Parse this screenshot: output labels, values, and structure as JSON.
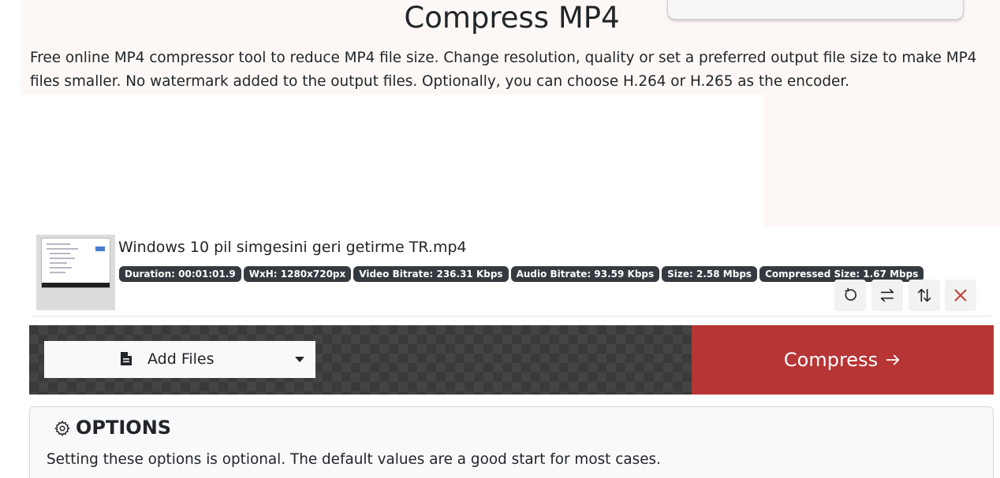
{
  "page": {
    "title": "Compress MP4",
    "description": "Free online MP4 compressor tool to reduce MP4 file size. Change resolution, quality or set a preferred output file size to make MP4 files smaller. No watermark added to the output files. Optionally, you can choose H.264 or H.265 as the encoder."
  },
  "file": {
    "name": "Windows 10 pil simgesini geri getirme TR.mp4",
    "badges": [
      "Duration: 00:01:01.9",
      "WxH: 1280x720px",
      "Video Bitrate: 236.31 Kbps",
      "Audio Bitrate: 93.59 Kbps",
      "Size: 2.58 Mbps",
      "Compressed Size: 1.67 Mbps"
    ],
    "actions": [
      "rotate-icon",
      "swap-horizontal-icon",
      "swap-vertical-icon",
      "close-icon"
    ]
  },
  "toolbar": {
    "add_files_label": "Add Files",
    "compress_label": "Compress"
  },
  "options": {
    "title": "OPTIONS",
    "help": "Setting these options is optional. The default values are a good start for most cases."
  },
  "colors": {
    "accent": "#b73535",
    "badge": "#343a40",
    "close": "#c0392b"
  }
}
